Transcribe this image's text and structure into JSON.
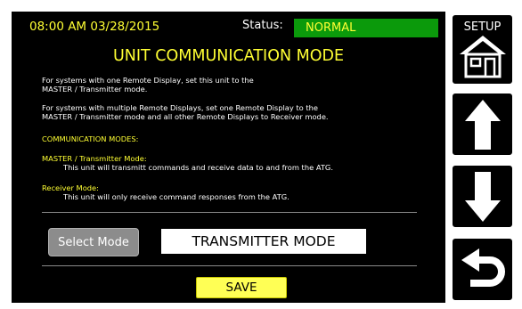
{
  "header": {
    "datetime": "08:00 AM 03/28/2015",
    "status_label": "Status:",
    "status_value": "NORMAL"
  },
  "title": "UNIT COMMUNICATION MODE",
  "info": {
    "para1_line1": "For systems with one Remote Display, set this unit to the",
    "para1_line2": "MASTER / Transmitter mode.",
    "para2_line1": "For systems with multiple Remote Displays, set one Remote Display to the",
    "para2_line2": "MASTER / Transmitter mode and all other Remote Displays to Receiver mode.",
    "modes_heading": "COMMUNICATION MODES:",
    "master_label": "MASTER / Transmitter Mode:",
    "master_desc": "This unit will transmitt commands and receive data to and from the ATG.",
    "receiver_label": "Receiver Mode:",
    "receiver_desc": "This unit will only receive command responses from the ATG."
  },
  "controls": {
    "select_mode_label": "Select Mode",
    "current_mode": "TRANSMITTER MODE",
    "save_label": "SAVE"
  },
  "sidebar": {
    "setup_label": "SETUP",
    "setup_icon": "house-icon",
    "up_icon": "up-arrow-icon",
    "down_icon": "down-arrow-icon",
    "back_icon": "return-arrow-icon"
  },
  "colors": {
    "accent_yellow": "#ffff33",
    "status_green": "#0b9a0b",
    "background": "#000000"
  }
}
